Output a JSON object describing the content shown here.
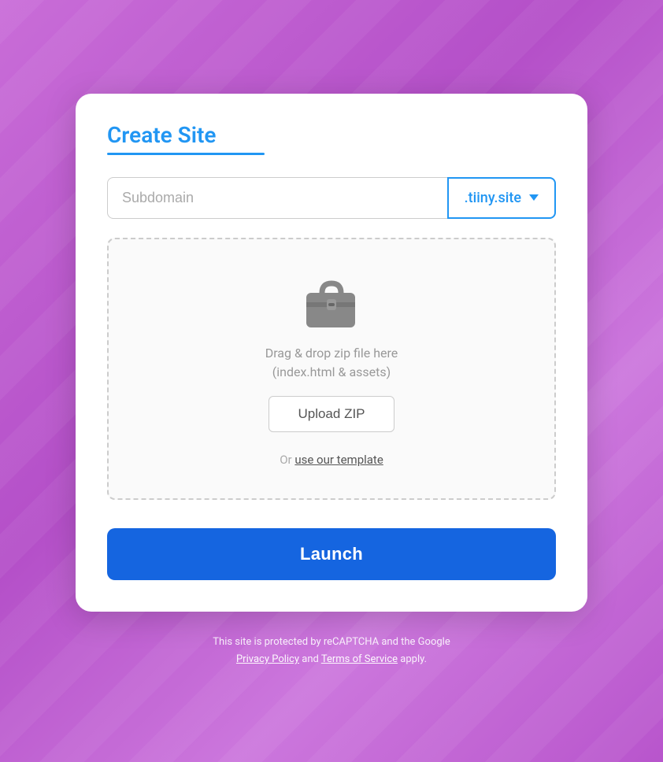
{
  "card": {
    "title": "Create Site",
    "subdomain": {
      "placeholder": "Subdomain",
      "domain_option": ".tiiny.site"
    },
    "dropzone": {
      "drag_text_line1": "Drag & drop zip file here",
      "drag_text_line2": "(index.html & assets)",
      "upload_button_label": "Upload ZIP",
      "or_text": "Or",
      "template_link_text": "use our template"
    },
    "launch_button_label": "Launch"
  },
  "footer": {
    "line1": "This site is protected by reCAPTCHA and the Google",
    "privacy_link": "Privacy Policy",
    "and_text": "and",
    "terms_link": "Terms of Service",
    "apply_text": "apply."
  },
  "icons": {
    "zip_icon": "zip-file-icon",
    "chevron_icon": "chevron-down-icon"
  }
}
